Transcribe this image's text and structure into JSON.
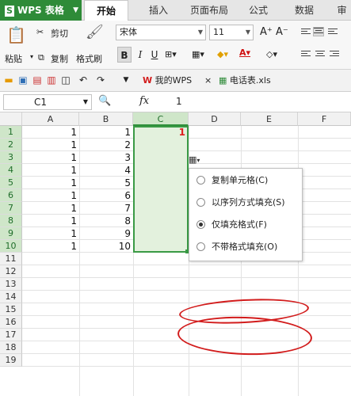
{
  "app": {
    "name": "WPS 表格",
    "logo_letter": "S"
  },
  "menu_tabs": [
    "开始",
    "插入",
    "页面布局",
    "公式",
    "数据",
    "审"
  ],
  "ribbon": {
    "cut": "剪切",
    "paste": "粘贴",
    "copy": "复制",
    "format_painter": "格式刷",
    "font_name": "宋体",
    "font_size": "11",
    "grow": "A⁺",
    "shrink": "A⁻",
    "bold": "B",
    "italic": "I",
    "underline": "U"
  },
  "doc_tabs": [
    {
      "label": "我的WPS",
      "close": "×"
    },
    {
      "label": "电话表.xls"
    }
  ],
  "formula_bar": {
    "cell_ref": "C1",
    "fx": "fx",
    "value": "1"
  },
  "columns": [
    "A",
    "B",
    "C",
    "D",
    "E",
    "F"
  ],
  "rows": [
    "1",
    "2",
    "3",
    "4",
    "5",
    "6",
    "7",
    "8",
    "9",
    "10",
    "11",
    "12",
    "13",
    "14",
    "15",
    "16",
    "17",
    "18",
    "19"
  ],
  "col_a": [
    "1",
    "1",
    "1",
    "1",
    "1",
    "1",
    "1",
    "1",
    "1",
    "1"
  ],
  "col_b": [
    "1",
    "2",
    "3",
    "4",
    "5",
    "6",
    "7",
    "8",
    "9",
    "10"
  ],
  "c1": "1",
  "autofill_menu": {
    "items": [
      {
        "label": "复制单元格(C)",
        "selected": false
      },
      {
        "label": "以序列方式填充(S)",
        "selected": false
      },
      {
        "label": "仅填充格式(F)",
        "selected": true
      },
      {
        "label": "不带格式填充(O)",
        "selected": false
      }
    ]
  },
  "colors": {
    "app_green": "#2e8b38",
    "selection": "#3a9a45",
    "annotation_red": "#d21c1c"
  }
}
